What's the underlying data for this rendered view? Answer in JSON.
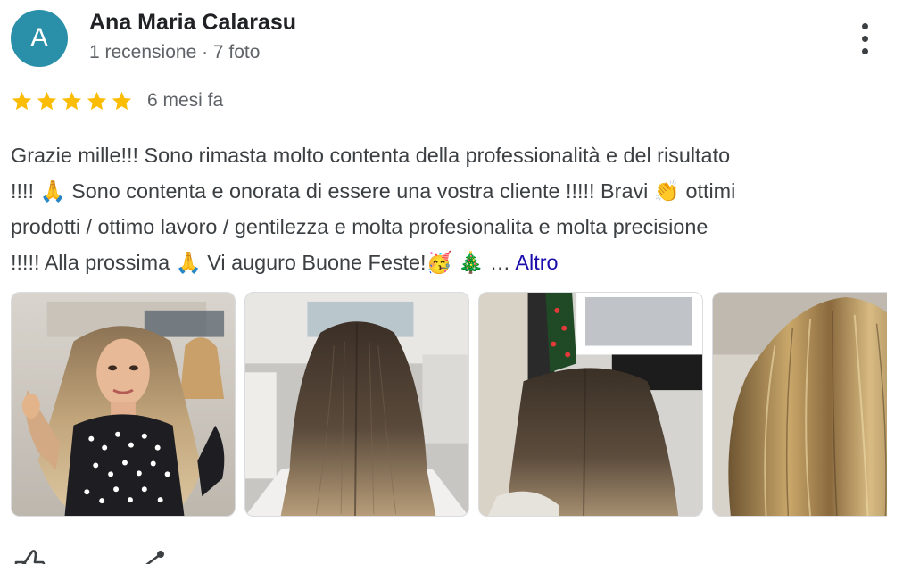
{
  "author": {
    "avatar_letter": "A",
    "avatar_color": "#2a8fa8",
    "name": "Ana Maria Calarasu",
    "meta": "1 recensione · 7 foto"
  },
  "menu": {
    "icon": "more-vert-icon"
  },
  "review": {
    "rating": 5,
    "rating_max": 5,
    "star_color": "#fbbc04",
    "date": "6 mesi fa",
    "text_lines": [
      "Grazie mille!!! Sono rimasta molto contenta della professionalità e del risultato",
      "!!!! 🙏 Sono contenta e onorata di essere una vostra cliente !!!!! Bravi 👏 ottimi",
      "prodotti / ottimo lavoro / gentilezza e molta profesionalita e molta precisione",
      "!!!!! Alla prossima 🙏 Vi auguro Buone Feste!🥳 🎄 …"
    ],
    "more_label": "Altro",
    "link_color": "#1a0dab"
  },
  "photos": [
    {
      "icon": "photo-woman-long-hair"
    },
    {
      "icon": "photo-hair-back-dark"
    },
    {
      "icon": "photo-hair-back-salon"
    },
    {
      "icon": "photo-hair-side-highlights"
    }
  ],
  "actions": [
    {
      "icon": "thumb-up-icon"
    },
    {
      "icon": "share-icon"
    }
  ]
}
